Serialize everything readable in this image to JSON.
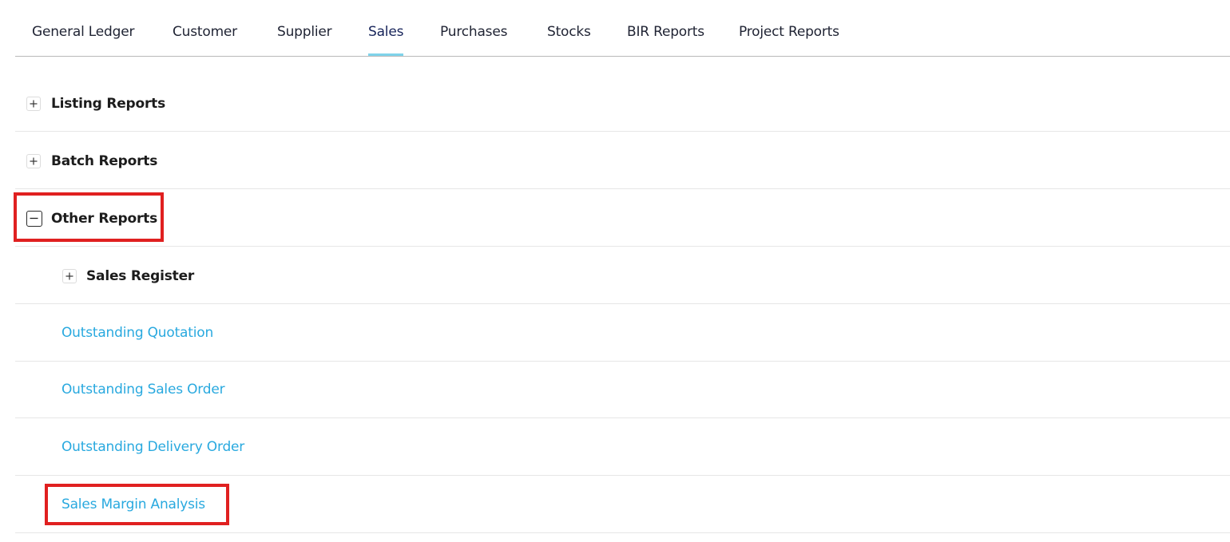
{
  "tabs": [
    {
      "label": "General Ledger",
      "active": false
    },
    {
      "label": "Customer",
      "active": false
    },
    {
      "label": "Supplier",
      "active": false
    },
    {
      "label": "Sales",
      "active": true
    },
    {
      "label": "Purchases",
      "active": false
    },
    {
      "label": "Stocks",
      "active": false
    },
    {
      "label": "BIR Reports",
      "active": false
    },
    {
      "label": "Project Reports",
      "active": false
    }
  ],
  "groups": {
    "listing_reports": {
      "label": "Listing Reports",
      "expanded": false
    },
    "batch_reports": {
      "label": "Batch Reports",
      "expanded": false
    },
    "other_reports": {
      "label": "Other Reports",
      "expanded": true
    },
    "sales_register": {
      "label": "Sales Register",
      "expanded": false
    }
  },
  "reports": {
    "outstanding_quotation": "Outstanding Quotation",
    "outstanding_sales_order": "Outstanding Sales Order",
    "outstanding_delivery_order": "Outstanding Delivery Order",
    "sales_margin_analysis": "Sales Margin Analysis"
  },
  "colors": {
    "link": "#29a9df",
    "active_tab_underline": "#7fd3ea",
    "highlight_annotation": "#e02020"
  },
  "icons": {
    "collapsed": "plus-icon",
    "expanded": "minus-icon"
  }
}
